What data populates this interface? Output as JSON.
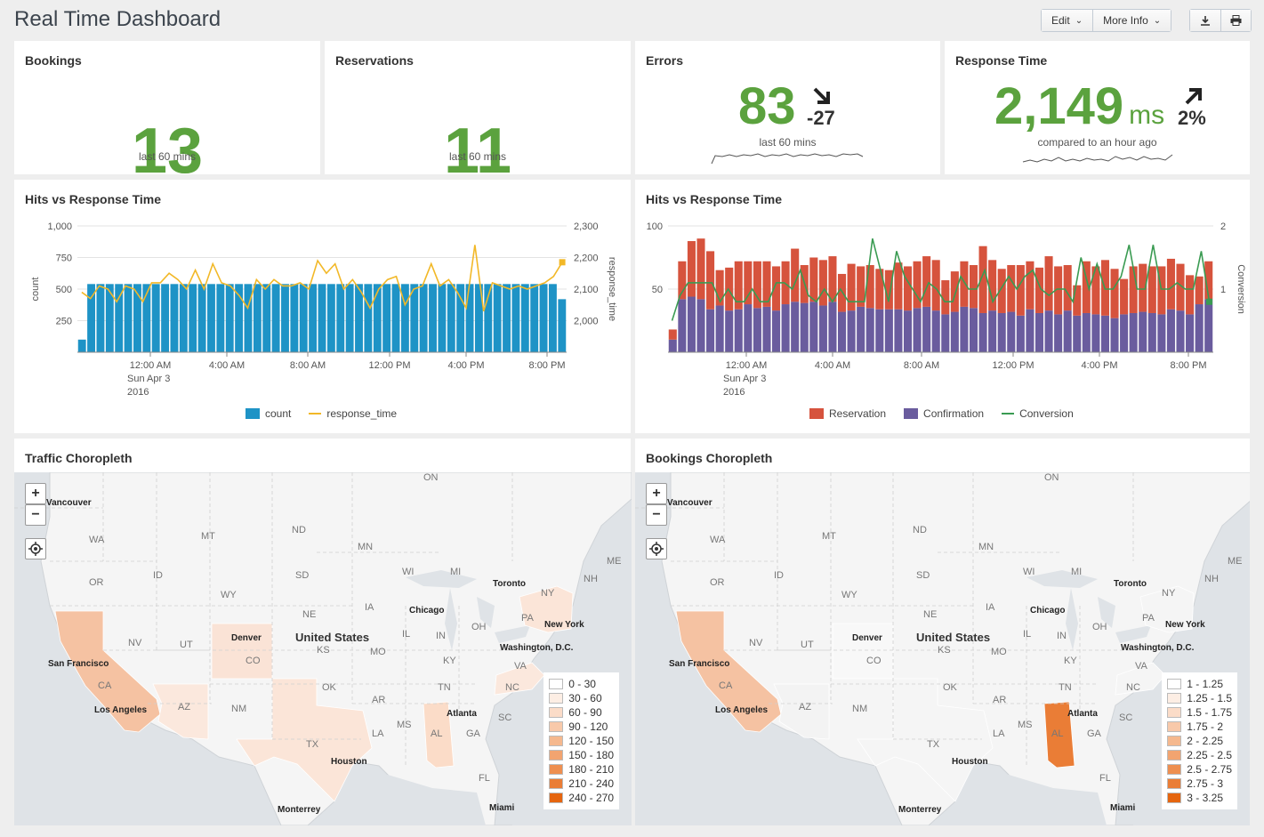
{
  "header": {
    "title": "Real Time Dashboard",
    "edit_label": "Edit",
    "more_info_label": "More Info",
    "download_icon": "download-icon",
    "print_icon": "print-icon"
  },
  "bookings": {
    "title": "Bookings",
    "value": "13",
    "caption": "last 60 mins"
  },
  "reservations": {
    "title": "Reservations",
    "value": "11",
    "caption": "last 60 mins"
  },
  "errors": {
    "title": "Errors",
    "value": "83",
    "delta": "-27",
    "trend_icon": "arrow-down-right-icon",
    "caption": "last 60 mins"
  },
  "response_time": {
    "title": "Response Time",
    "value": "2,149",
    "unit": "ms",
    "delta": "2%",
    "trend_icon": "arrow-up-right-icon",
    "caption": "compared to an hour ago"
  },
  "colors": {
    "green": "#5ba23e",
    "count": "#1e93c6",
    "response_time": "#f2b827",
    "reservation": "#d6533d",
    "confirmation": "#6a5c9e",
    "conversion": "#3a9b52"
  },
  "hits_left": {
    "title": "Hits vs Response Time",
    "legend": {
      "count": "count",
      "response_time": "response_time"
    }
  },
  "hits_right": {
    "title": "Hits vs Response Time",
    "legend": {
      "reservation": "Reservation",
      "confirmation": "Confirmation",
      "conversion": "Conversion"
    }
  },
  "chart_data": [
    {
      "type": "bar",
      "title": "Hits vs Response Time",
      "xlabel": "",
      "ylabel": "count",
      "y2label": "response_time",
      "ylim": [
        0,
        1000
      ],
      "y2lim": [
        1900,
        2300
      ],
      "yticks": [
        "250",
        "500",
        "750",
        "1,000"
      ],
      "y2ticks": [
        "2,000",
        "2,100",
        "2,200",
        "2,300"
      ],
      "xticks": [
        "12:00 AM",
        "4:00 AM",
        "8:00 AM",
        "12:00 PM",
        "4:00 PM",
        "8:00 PM"
      ],
      "xtick_sub": [
        "Sun Apr 3",
        "2016"
      ],
      "series": [
        {
          "name": "count",
          "kind": "bar",
          "values": [
            100,
            540,
            540,
            540,
            540,
            540,
            540,
            540,
            540,
            540,
            540,
            540,
            540,
            540,
            540,
            540,
            540,
            540,
            540,
            540,
            540,
            540,
            540,
            540,
            540,
            540,
            540,
            540,
            540,
            540,
            540,
            540,
            540,
            540,
            540,
            540,
            540,
            540,
            540,
            540,
            540,
            540,
            540,
            540,
            540,
            540,
            540,
            540,
            540,
            540,
            540,
            540,
            420
          ]
        },
        {
          "name": "response_time",
          "kind": "line",
          "axis": "y2",
          "values": [
            2090,
            2070,
            2110,
            2100,
            2060,
            2110,
            2100,
            2060,
            2120,
            2120,
            2150,
            2130,
            2100,
            2160,
            2100,
            2180,
            2120,
            2110,
            2080,
            2040,
            2130,
            2100,
            2130,
            2110,
            2110,
            2120,
            2100,
            2190,
            2150,
            2180,
            2100,
            2130,
            2090,
            2040,
            2100,
            2130,
            2140,
            2050,
            2100,
            2110,
            2180,
            2110,
            2130,
            2090,
            2040,
            2240,
            2030,
            2120,
            2110,
            2100,
            2110,
            2100,
            2110,
            2120,
            2140,
            2185
          ]
        }
      ]
    },
    {
      "type": "bar",
      "title": "Hits vs Response Time",
      "xlabel": "",
      "ylabel": "",
      "y2label": "Conversion",
      "ylim": [
        0,
        100
      ],
      "y2lim": [
        0,
        2
      ],
      "yticks": [
        "50",
        "100"
      ],
      "y2ticks": [
        "1",
        "2"
      ],
      "xticks": [
        "12:00 AM",
        "4:00 AM",
        "8:00 AM",
        "12:00 PM",
        "4:00 PM",
        "8:00 PM"
      ],
      "xtick_sub": [
        "Sun Apr 3",
        "2016"
      ],
      "series": [
        {
          "name": "Confirmation",
          "kind": "bar",
          "values": [
            10,
            42,
            44,
            42,
            34,
            37,
            33,
            34,
            38,
            35,
            36,
            33,
            38,
            40,
            39,
            40,
            37,
            40,
            32,
            33,
            36,
            35,
            34,
            34,
            34,
            33,
            35,
            36,
            33,
            30,
            32,
            36,
            35,
            31,
            33,
            31,
            32,
            29,
            34,
            31,
            33,
            30,
            33,
            29,
            31,
            30,
            29,
            27,
            30,
            31,
            32,
            31,
            30,
            34,
            33,
            30,
            38,
            42
          ]
        },
        {
          "name": "Reservation",
          "kind": "bar",
          "stacked": true,
          "values": [
            8,
            30,
            44,
            48,
            46,
            28,
            34,
            38,
            34,
            37,
            36,
            35,
            34,
            42,
            30,
            35,
            36,
            36,
            30,
            37,
            32,
            34,
            32,
            31,
            37,
            35,
            37,
            40,
            40,
            27,
            32,
            36,
            34,
            53,
            40,
            35,
            37,
            40,
            38,
            36,
            43,
            38,
            36,
            24,
            41,
            38,
            44,
            39,
            28,
            37,
            38,
            37,
            38,
            40,
            37,
            31,
            22,
            30
          ]
        },
        {
          "name": "Conversion",
          "kind": "line",
          "axis": "y2",
          "values": [
            0.5,
            0.9,
            1.1,
            1.1,
            1.1,
            1.1,
            0.8,
            1.0,
            0.8,
            0.8,
            1.0,
            0.8,
            0.8,
            1.1,
            1.1,
            1.0,
            1.3,
            0.9,
            0.8,
            1.0,
            0.8,
            1.0,
            0.8,
            0.8,
            0.8,
            1.8,
            1.3,
            0.8,
            1.6,
            1.2,
            1.0,
            0.8,
            1.1,
            1.0,
            0.8,
            0.8,
            1.2,
            1.0,
            1.0,
            1.3,
            0.8,
            1.0,
            1.2,
            1.0,
            1.2,
            1.3,
            1.0,
            0.9,
            1.0,
            1.0,
            0.8,
            1.5,
            1.0,
            1.4,
            1.0,
            1.0,
            1.2,
            1.7,
            1.0,
            1.0,
            1.7,
            1.0,
            1.0,
            1.1,
            1.0,
            1.0,
            1.6,
            0.8
          ]
        }
      ]
    }
  ],
  "traffic_map": {
    "title": "Traffic Choropleth",
    "zoom_in_label": "+",
    "zoom_out_label": "−",
    "legend": [
      "0 - 30",
      "30 - 60",
      "60 - 90",
      "90 - 120",
      "120 - 150",
      "150 - 180",
      "180 - 210",
      "210 - 240",
      "240 - 270"
    ]
  },
  "bookings_map": {
    "title": "Bookings Choropleth",
    "zoom_in_label": "+",
    "zoom_out_label": "−",
    "legend": [
      "1 - 1.25",
      "1.25 - 1.5",
      "1.5 - 1.75",
      "1.75 - 2",
      "2 - 2.25",
      "2.25 - 2.5",
      "2.5 - 2.75",
      "2.75 - 3",
      "3 - 3.25"
    ]
  },
  "map_legend_colors": [
    "#ffffff",
    "#fdeee4",
    "#fbdcc8",
    "#f8c9aa",
    "#f5b88e",
    "#f2a470",
    "#ee8f50",
    "#ea7d36",
    "#e5650f"
  ],
  "map_labels": {
    "states": [
      "WA",
      "MT",
      "ND",
      "MN",
      "OR",
      "ID",
      "WY",
      "SD",
      "WI",
      "MI",
      "NE",
      "IA",
      "NV",
      "UT",
      "CO",
      "KS",
      "MO",
      "IL",
      "IN",
      "OH",
      "PA",
      "NY",
      "CA",
      "AZ",
      "NM",
      "TX",
      "OK",
      "AR",
      "TN",
      "KY",
      "VA",
      "NC",
      "SC",
      "GA",
      "AL",
      "MS",
      "LA",
      "FL",
      "ON",
      "ME",
      "NH"
    ],
    "cities": [
      "Vancouver",
      "San Francisco",
      "Los Angeles",
      "Denver",
      "Chicago",
      "Toronto",
      "New York",
      "Washington, D.C.",
      "Atlanta",
      "Houston",
      "Monterrey",
      "Miami"
    ],
    "country": "United States"
  }
}
